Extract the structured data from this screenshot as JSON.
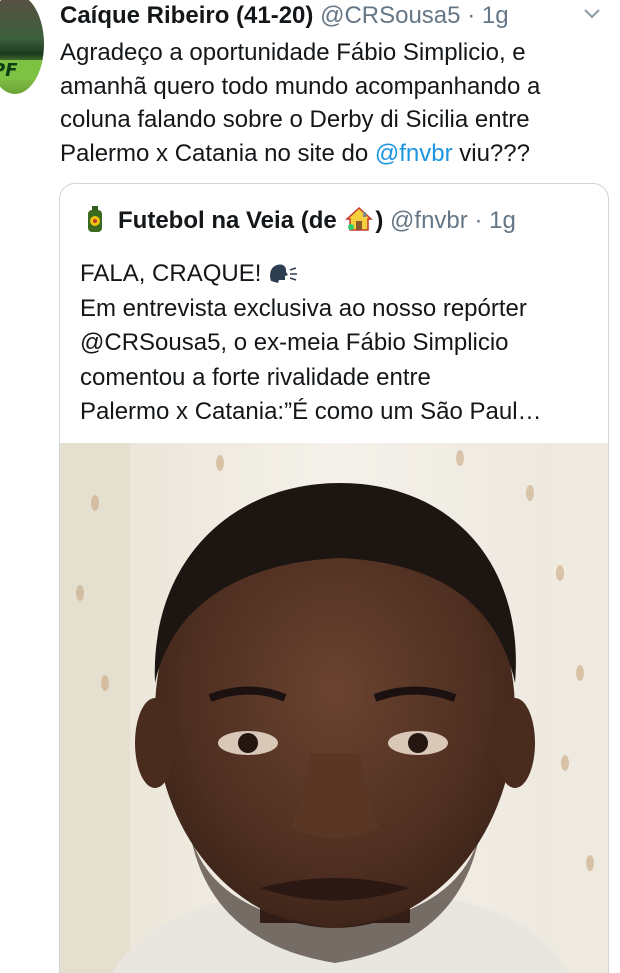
{
  "tweet": {
    "author_name": "Caíque Ribeiro (41-20)",
    "author_handle": "@CRSousa5",
    "separator": "·",
    "time": "1g",
    "text_part1": "Agradeço a oportunidade Fábio Simplicio, e amanhã quero todo mundo acompanhando a coluna falando sobre o Derby di Sicilia entre Palermo x Catania no site do ",
    "mention": "@fnvbr",
    "text_part2": " viu???",
    "avatar_text": "PF"
  },
  "quoted": {
    "name_prefix": "Futebol na Veia (de ",
    "name_suffix": ")",
    "handle": "@fnvbr",
    "separator": "·",
    "time": "1g",
    "lines": [
      "FALA, CRAQUE!",
      "Em entrevista exclusiva ao nosso repórter",
      "@CRSousa5, o ex-meia Fábio Simplicio",
      "comentou a forte rivalidade entre",
      "Palermo x Catania:”É como um São Paul…"
    ]
  },
  "colors": {
    "link": "#1b95e0",
    "text": "#14171a",
    "secondary": "#657786",
    "border": "#ccd6dd"
  },
  "icons": [
    "chevron-down-icon",
    "guarana-bottle-icon",
    "house-icon",
    "speaking-head-icon"
  ]
}
